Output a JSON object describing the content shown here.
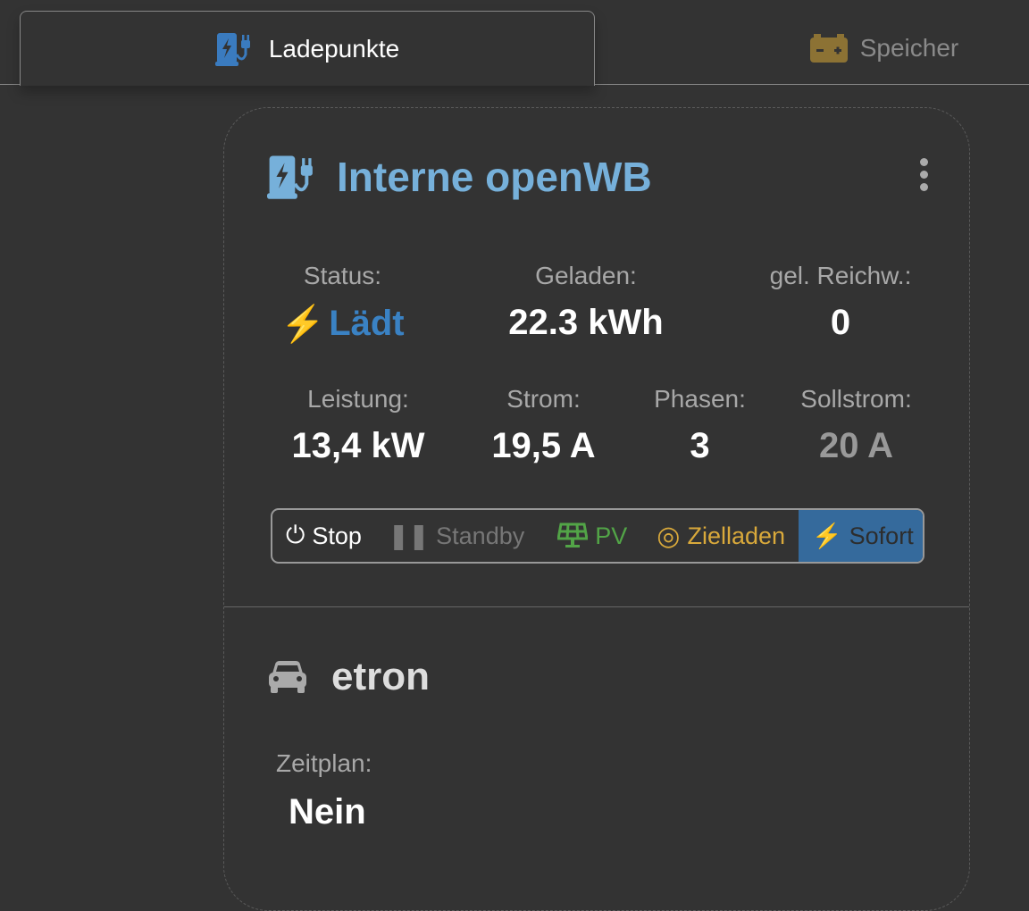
{
  "tabs": [
    {
      "label": "Ladepunkte",
      "icon": "charging-station-icon",
      "active": true
    },
    {
      "label": "Speicher",
      "icon": "battery-icon",
      "active": false
    }
  ],
  "chargepoint": {
    "name": "Interne openWB",
    "status": {
      "label": "Status:",
      "value": "Lädt"
    },
    "charged": {
      "label": "Geladen:",
      "value": "22.3 kWh"
    },
    "range": {
      "label": "gel. Reichw.:",
      "value": "0"
    },
    "power": {
      "label": "Leistung:",
      "value": "13,4 kW"
    },
    "current": {
      "label": "Strom:",
      "value": "19,5 A"
    },
    "phases": {
      "label": "Phasen:",
      "value": "3"
    },
    "target_current": {
      "label": "Sollstrom:",
      "value": "20 A"
    },
    "modes": [
      {
        "label": "Stop"
      },
      {
        "label": "Standby"
      },
      {
        "label": "PV"
      },
      {
        "label": "Zielladen"
      },
      {
        "label": "Sofort",
        "selected": true
      }
    ]
  },
  "vehicle": {
    "name": "etron",
    "schedule": {
      "label": "Zeitplan:",
      "value": "Nein"
    }
  },
  "colors": {
    "accent": "#76b0da",
    "charging": "#3a82c4",
    "selected": "#356a9c",
    "pv": "#52a447",
    "target": "#d9a93b",
    "battery": "#8c7234"
  }
}
